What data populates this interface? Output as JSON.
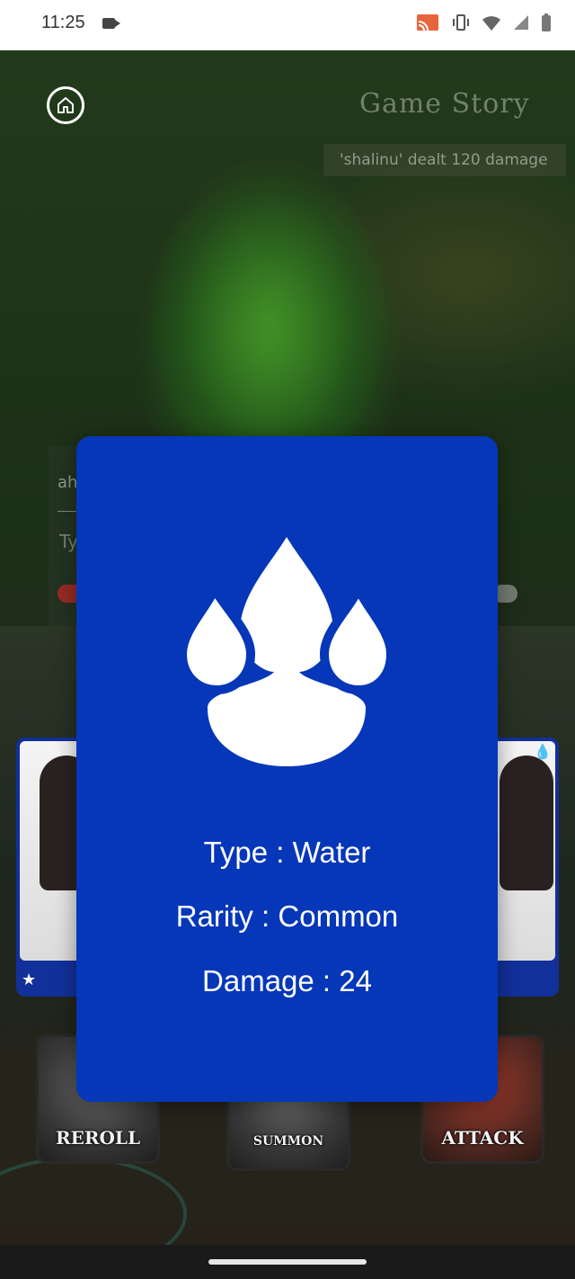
{
  "status_bar": {
    "time": "11:25"
  },
  "scene": {
    "title": "Game Story",
    "log_entry": "'shalinu' dealt 120 damage",
    "chat_preview": "ah",
    "chat_input_hint": "Ty"
  },
  "actions": {
    "reroll": "REROLL",
    "summon": "SUMMON",
    "attack": "ATTACK"
  },
  "card": {
    "icon": "water-drops-icon",
    "background_color": "#0637b9",
    "type_line": "Type : Water",
    "rarity_line": "Rarity : Common",
    "damage_line": "Damage : 24"
  }
}
